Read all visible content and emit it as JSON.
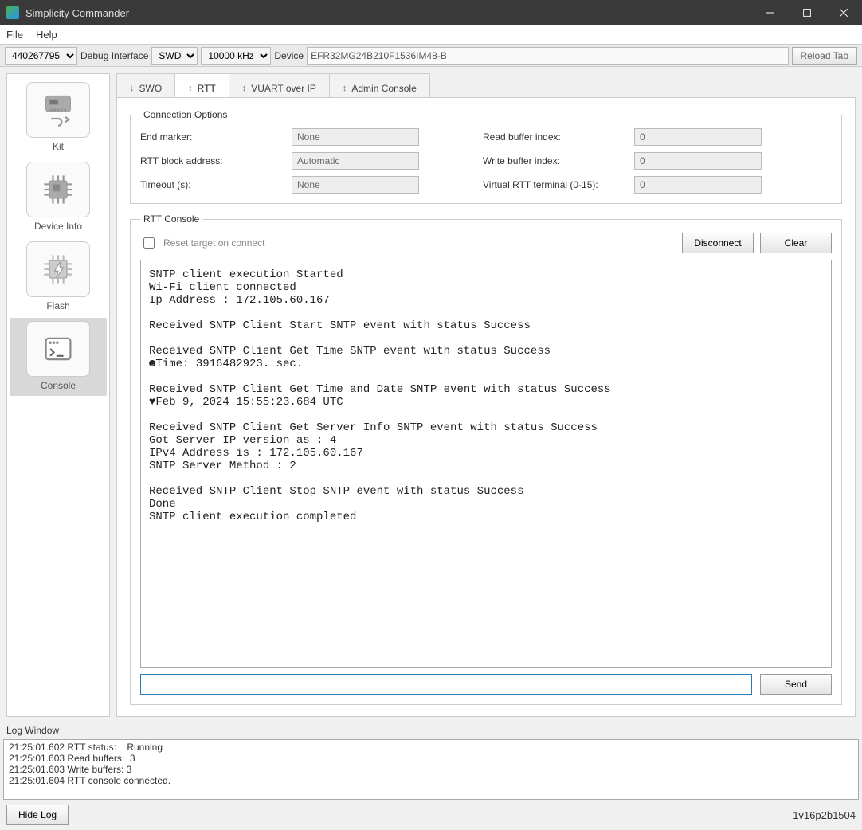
{
  "window": {
    "title": "Simplicity Commander",
    "menu": {
      "file": "File",
      "help": "Help"
    }
  },
  "toolbar": {
    "serial": "440267795",
    "debug_label": "Debug Interface",
    "debug_value": "SWD",
    "freq_value": "10000 kHz",
    "device_label": "Device",
    "device_value": "EFR32MG24B210F1536IM48-B",
    "reload_label": "Reload Tab"
  },
  "sidebar": {
    "items": [
      {
        "id": "kit",
        "label": "Kit"
      },
      {
        "id": "deviceinfo",
        "label": "Device Info"
      },
      {
        "id": "flash",
        "label": "Flash"
      },
      {
        "id": "console",
        "label": "Console"
      }
    ],
    "selected": 3
  },
  "tabs": {
    "items": [
      {
        "arr": "↓",
        "label": "SWO"
      },
      {
        "arr": "↕",
        "label": "RTT"
      },
      {
        "arr": "↕",
        "label": "VUART over IP"
      },
      {
        "arr": "↕",
        "label": "Admin Console"
      }
    ],
    "active": 1
  },
  "conn_opts": {
    "legend": "Connection Options",
    "end_marker_label": "End marker:",
    "end_marker_value": "None",
    "rtt_block_label": "RTT block address:",
    "rtt_block_value": "Automatic",
    "timeout_label": "Timeout (s):",
    "timeout_value": "None",
    "read_buf_label": "Read buffer index:",
    "read_buf_value": "0",
    "write_buf_label": "Write buffer index:",
    "write_buf_value": "0",
    "vterm_label": "Virtual RTT terminal (0-15):",
    "vterm_value": "0"
  },
  "rtt": {
    "legend": "RTT Console",
    "reset_label": "Reset target on connect",
    "disconnect_label": "Disconnect",
    "clear_label": "Clear",
    "send_label": "Send",
    "console_text": "SNTP client execution Started\nWi-Fi client connected\nIp Address : 172.105.60.167\n\nReceived SNTP Client Start SNTP event with status Success\n\nReceived SNTP Client Get Time SNTP event with status Success\n☻Time: 3916482923. sec.\n\nReceived SNTP Client Get Time and Date SNTP event with status Success\n♥Feb 9, 2024 15:55:23.684 UTC\n\nReceived SNTP Client Get Server Info SNTP event with status Success\nGot Server IP version as : 4\nIPv4 Address is : 172.105.60.167\nSNTP Server Method : 2\n\nReceived SNTP Client Stop SNTP event with status Success\nDone\nSNTP client execution completed"
  },
  "log": {
    "title": "Log Window",
    "text": "21:25:01.602 RTT status:    Running\n21:25:01.603 Read buffers:  3\n21:25:01.603 Write buffers: 3\n21:25:01.604 RTT console connected.",
    "hide_label": "Hide Log",
    "version": "1v16p2b1504"
  }
}
